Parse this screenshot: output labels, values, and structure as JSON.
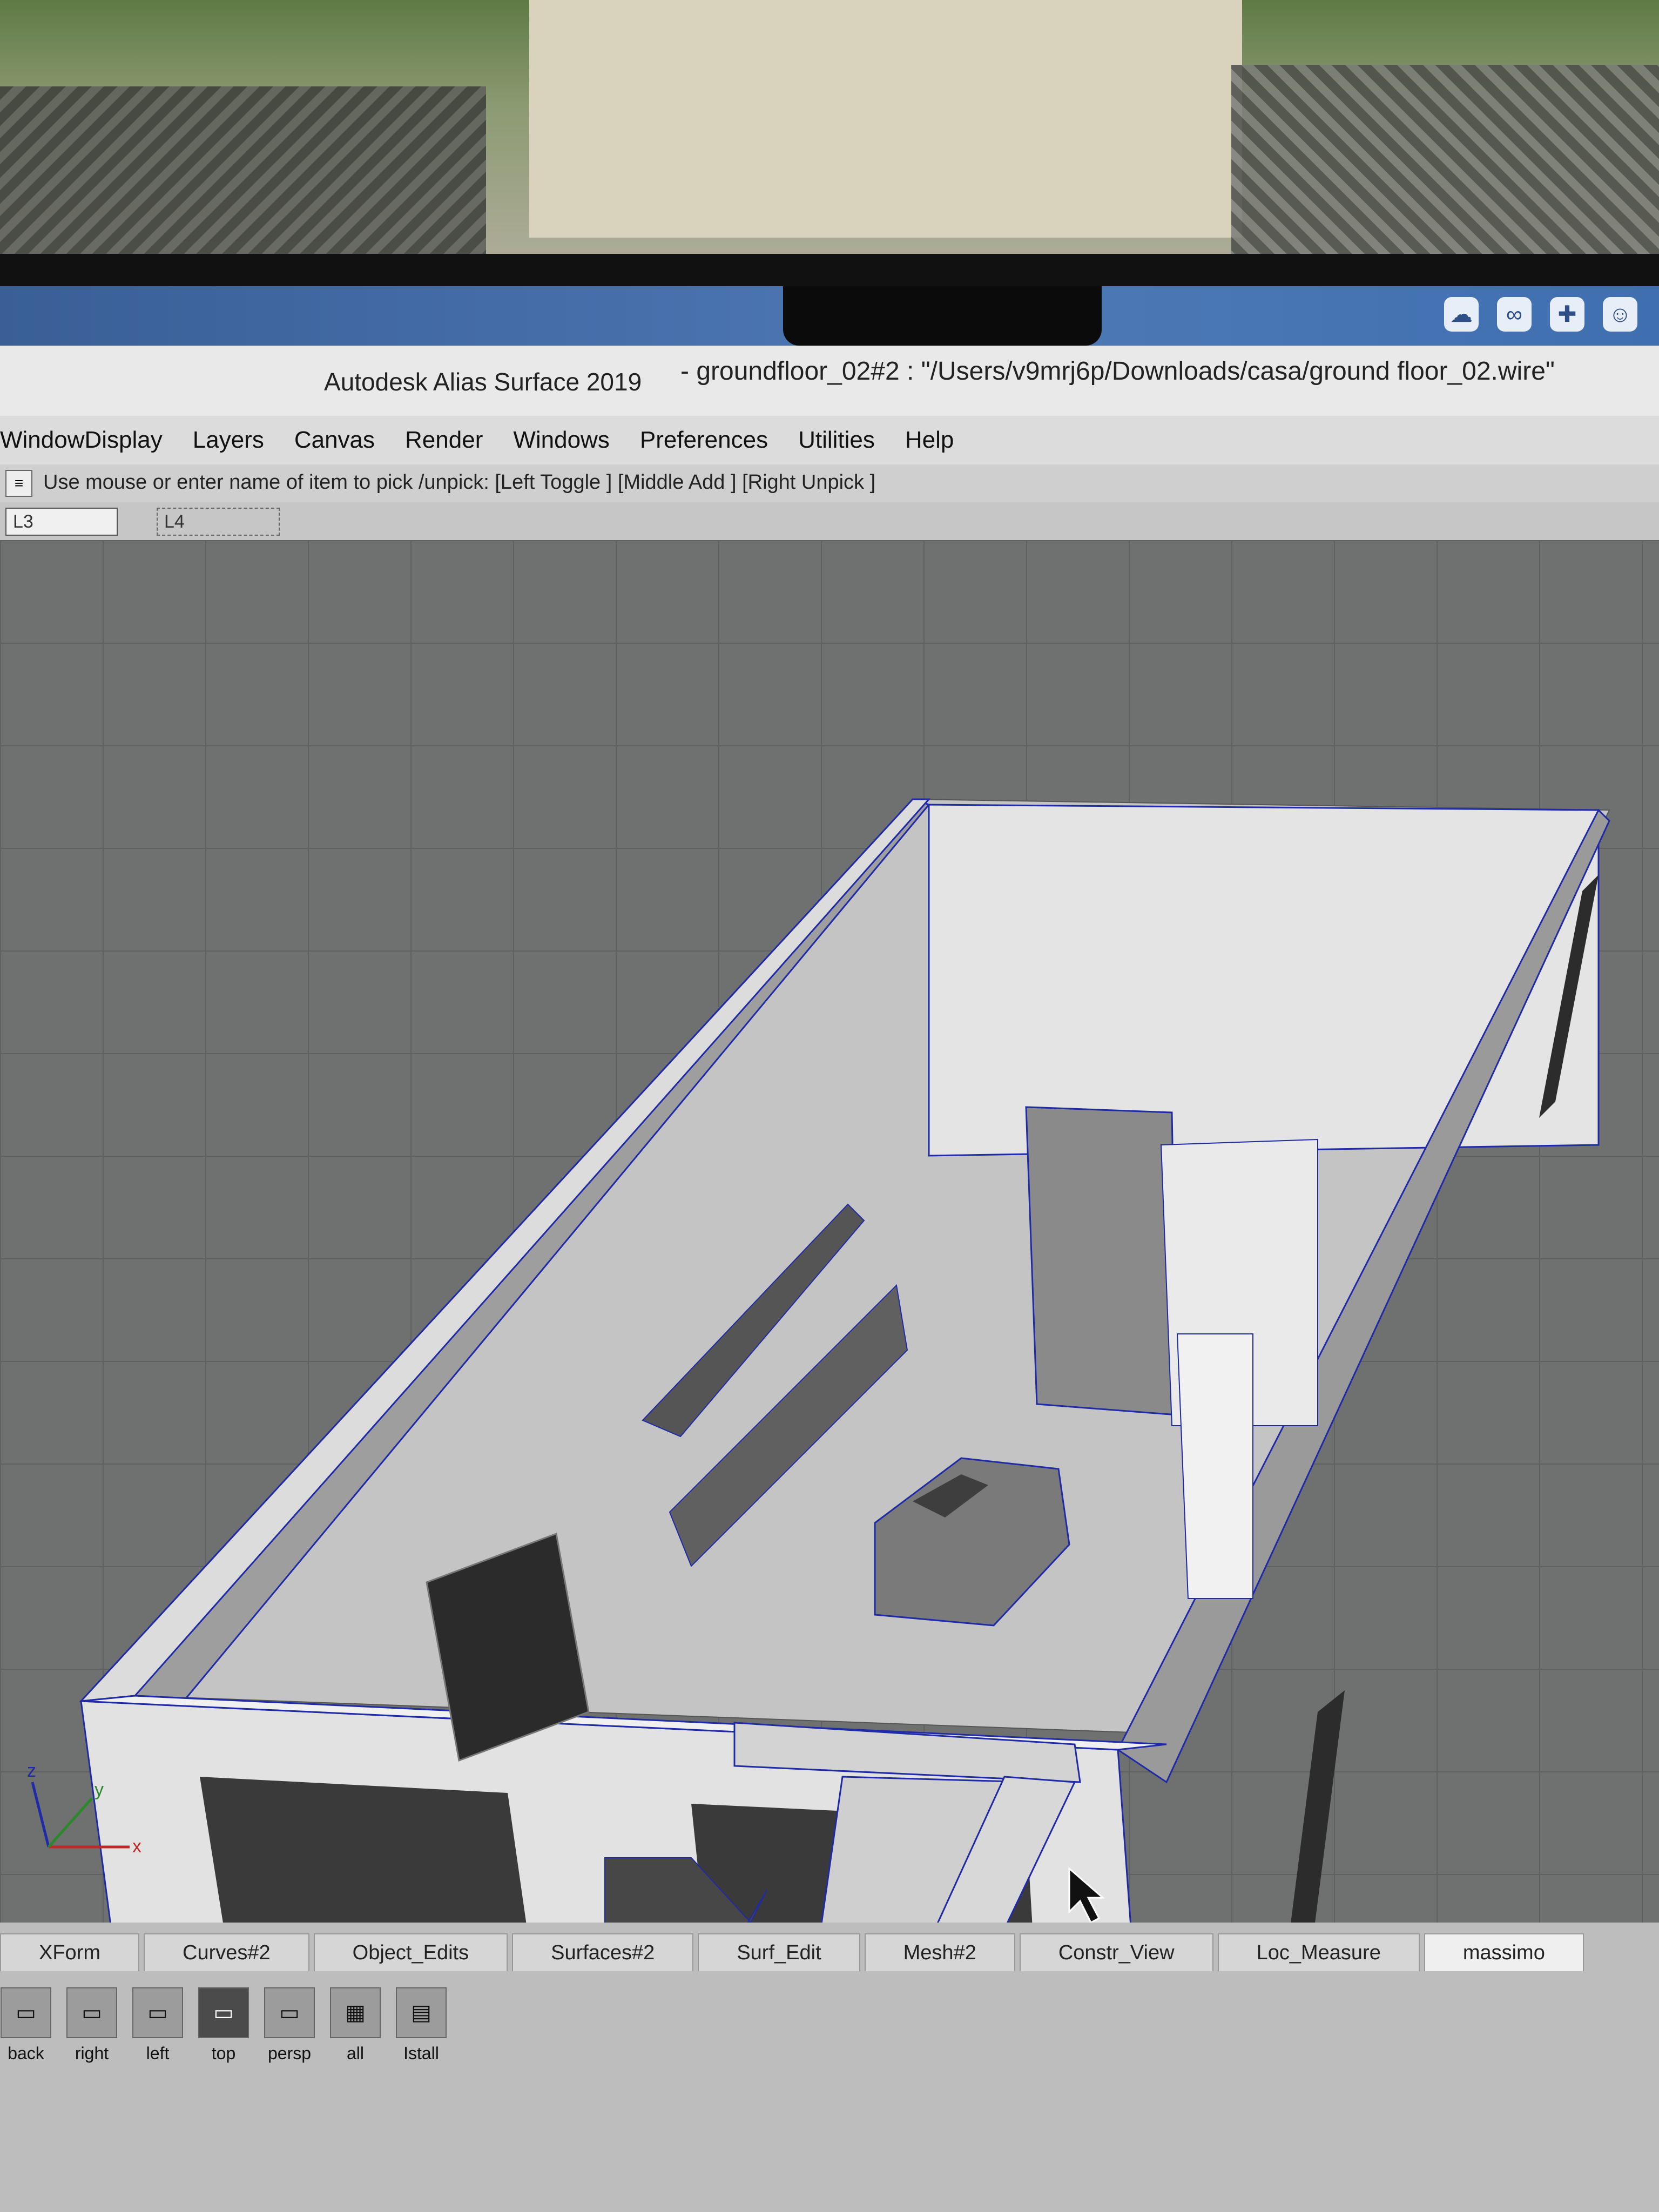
{
  "status_icons": [
    "cloud-sync-icon",
    "link-icon",
    "plus-icon",
    "users-icon"
  ],
  "window": {
    "app_title": "Autodesk Alias Surface 2019",
    "file_title": "- groundfloor_02#2 : \"/Users/v9mrj6p/Downloads/casa/ground floor_02.wire\""
  },
  "menu": [
    "WindowDisplay",
    "Layers",
    "Canvas",
    "Render",
    "Windows",
    "Preferences",
    "Utilities",
    "Help"
  ],
  "prompt": "Use mouse or enter name of item to pick /unpick: [Left Toggle ] [Middle Add ] [Right Unpick ]",
  "layers": [
    "L3",
    "L4"
  ],
  "axes": {
    "x": "x",
    "y": "y",
    "z": "z"
  },
  "shelf_tabs": [
    "XForm",
    "Curves#2",
    "Object_Edits",
    "Surfaces#2",
    "Surf_Edit",
    "Mesh#2",
    "Constr_View",
    "Loc_Measure",
    "massimo"
  ],
  "tools": [
    "back",
    "right",
    "left",
    "top",
    "persp",
    "all",
    "Istall"
  ],
  "colors": {
    "viewport": "#7e7e7e",
    "wall": "#e2e2e2",
    "selection": "#1f2aa8"
  }
}
